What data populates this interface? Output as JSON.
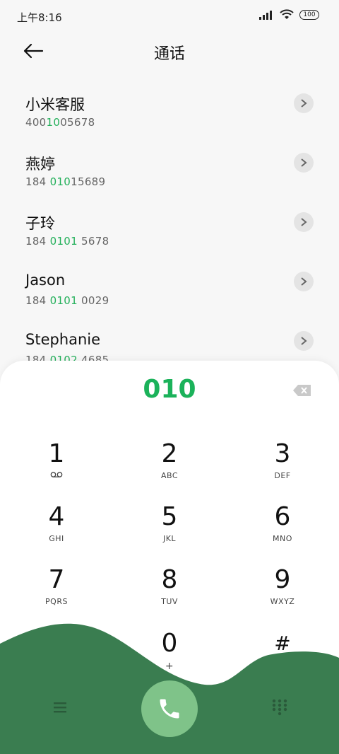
{
  "status": {
    "time": "上午8:16",
    "battery": "100"
  },
  "header": {
    "title": "通话"
  },
  "contacts": [
    {
      "name": "小米客服",
      "num_pre": "400",
      "num_hl": "10",
      "num_post": "05678"
    },
    {
      "name": "燕婷",
      "num_pre": "184 ",
      "num_hl": "010",
      "num_post": "15689"
    },
    {
      "name": "子玲",
      "num_pre": "184 ",
      "num_hl": "0101",
      "num_post": " 5678"
    },
    {
      "name": "Jason",
      "num_pre": "184 ",
      "num_hl": "0101",
      "num_post": " 0029"
    },
    {
      "name": "Stephanie",
      "num_pre": "184 ",
      "num_hl": "0102",
      "num_post": " 4685"
    }
  ],
  "dialer": {
    "typed": "010",
    "keys": [
      {
        "digit": "1",
        "letters": ""
      },
      {
        "digit": "2",
        "letters": "ABC"
      },
      {
        "digit": "3",
        "letters": "DEF"
      },
      {
        "digit": "4",
        "letters": "GHI"
      },
      {
        "digit": "5",
        "letters": "JKL"
      },
      {
        "digit": "6",
        "letters": "MNO"
      },
      {
        "digit": "7",
        "letters": "PQRS"
      },
      {
        "digit": "8",
        "letters": "TUV"
      },
      {
        "digit": "9",
        "letters": "WXYZ"
      },
      {
        "digit": "*",
        "letters": ","
      },
      {
        "digit": "0",
        "letters": "+"
      },
      {
        "digit": "#",
        "letters": ""
      }
    ]
  },
  "colors": {
    "accent": "#1bb25a",
    "wave": "#3a7d50",
    "call": "#7fc389"
  },
  "icons": [
    "back-arrow-icon",
    "chevron-right-icon",
    "backspace-icon",
    "voicemail-icon",
    "menu-icon",
    "phone-icon",
    "dialpad-icon",
    "signal-icon",
    "wifi-icon",
    "battery-icon"
  ]
}
